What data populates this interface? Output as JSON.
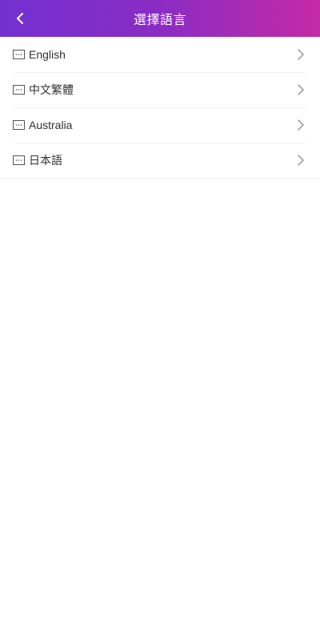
{
  "header": {
    "title": "選擇語言",
    "back_icon": "chevron-left-icon"
  },
  "colors": {
    "header_gradient_start": "#7330d0",
    "header_gradient_end": "#c52aa6",
    "text": "#323233",
    "chevron": "#969799"
  },
  "languages": [
    {
      "label": "English",
      "icon": "message-icon"
    },
    {
      "label": "中文繁體",
      "icon": "message-icon"
    },
    {
      "label": "Australia",
      "icon": "message-icon"
    },
    {
      "label": "日本語",
      "icon": "message-icon"
    }
  ]
}
